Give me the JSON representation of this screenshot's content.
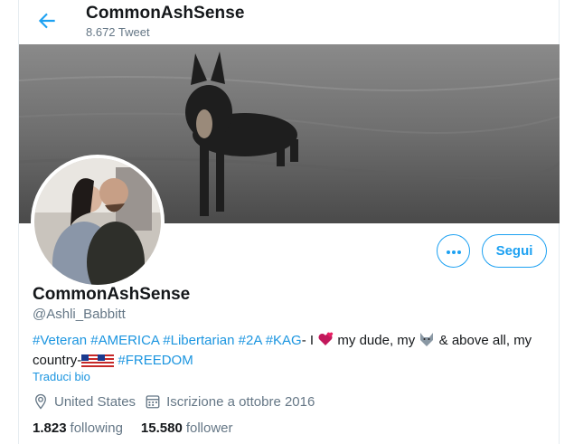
{
  "header": {
    "title": "CommonAshSense",
    "tweet_count": "8.672 Tweet"
  },
  "actions": {
    "follow_label": "Segui"
  },
  "profile": {
    "name": "CommonAshSense",
    "handle": "@Ashli_Babbitt",
    "bio": {
      "tags_1": [
        "#Veteran",
        "#AMERICA",
        "#Libertarian",
        "#2A",
        "#KAG"
      ],
      "text_1": "- I",
      "text_2": "my dude, my",
      "text_3": "& above all, my",
      "text_4": "country-",
      "tag_last": "#FREEDOM"
    },
    "translate_label": "Traduci bio",
    "location": "United States",
    "joined": "Iscrizione a ottobre 2016",
    "following_count": "1.823",
    "following_label": "following",
    "followers_count": "15.580",
    "followers_label": "follower"
  },
  "icons": {
    "back": "arrow-left-icon",
    "more": "more-horizontal-icon",
    "location": "location-pin-icon",
    "calendar": "calendar-icon",
    "heart": "two-hearts-emoji",
    "wolf": "wolf-emoji",
    "flag": "us-flag-emoji"
  },
  "colors": {
    "accent": "#1da1f2",
    "link": "#1b95e0",
    "secondary_text": "#657786"
  }
}
